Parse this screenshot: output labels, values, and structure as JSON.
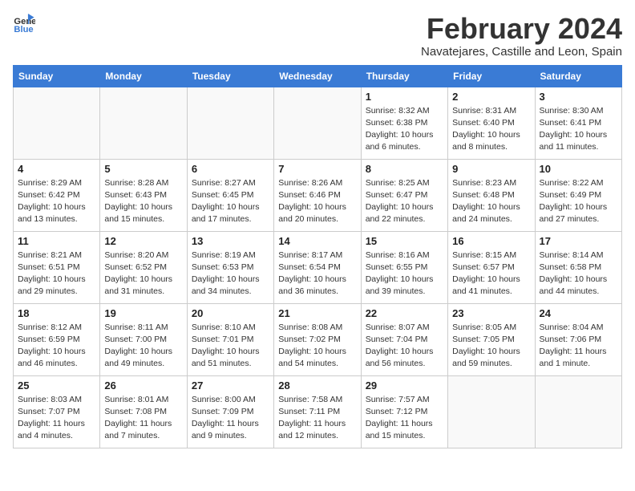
{
  "header": {
    "logo_general": "General",
    "logo_blue": "Blue",
    "title": "February 2024",
    "subtitle": "Navatejares, Castille and Leon, Spain"
  },
  "days_of_week": [
    "Sunday",
    "Monday",
    "Tuesday",
    "Wednesday",
    "Thursday",
    "Friday",
    "Saturday"
  ],
  "weeks": [
    [
      {
        "day": "",
        "info": ""
      },
      {
        "day": "",
        "info": ""
      },
      {
        "day": "",
        "info": ""
      },
      {
        "day": "",
        "info": ""
      },
      {
        "day": "1",
        "info": "Sunrise: 8:32 AM\nSunset: 6:38 PM\nDaylight: 10 hours\nand 6 minutes."
      },
      {
        "day": "2",
        "info": "Sunrise: 8:31 AM\nSunset: 6:40 PM\nDaylight: 10 hours\nand 8 minutes."
      },
      {
        "day": "3",
        "info": "Sunrise: 8:30 AM\nSunset: 6:41 PM\nDaylight: 10 hours\nand 11 minutes."
      }
    ],
    [
      {
        "day": "4",
        "info": "Sunrise: 8:29 AM\nSunset: 6:42 PM\nDaylight: 10 hours\nand 13 minutes."
      },
      {
        "day": "5",
        "info": "Sunrise: 8:28 AM\nSunset: 6:43 PM\nDaylight: 10 hours\nand 15 minutes."
      },
      {
        "day": "6",
        "info": "Sunrise: 8:27 AM\nSunset: 6:45 PM\nDaylight: 10 hours\nand 17 minutes."
      },
      {
        "day": "7",
        "info": "Sunrise: 8:26 AM\nSunset: 6:46 PM\nDaylight: 10 hours\nand 20 minutes."
      },
      {
        "day": "8",
        "info": "Sunrise: 8:25 AM\nSunset: 6:47 PM\nDaylight: 10 hours\nand 22 minutes."
      },
      {
        "day": "9",
        "info": "Sunrise: 8:23 AM\nSunset: 6:48 PM\nDaylight: 10 hours\nand 24 minutes."
      },
      {
        "day": "10",
        "info": "Sunrise: 8:22 AM\nSunset: 6:49 PM\nDaylight: 10 hours\nand 27 minutes."
      }
    ],
    [
      {
        "day": "11",
        "info": "Sunrise: 8:21 AM\nSunset: 6:51 PM\nDaylight: 10 hours\nand 29 minutes."
      },
      {
        "day": "12",
        "info": "Sunrise: 8:20 AM\nSunset: 6:52 PM\nDaylight: 10 hours\nand 31 minutes."
      },
      {
        "day": "13",
        "info": "Sunrise: 8:19 AM\nSunset: 6:53 PM\nDaylight: 10 hours\nand 34 minutes."
      },
      {
        "day": "14",
        "info": "Sunrise: 8:17 AM\nSunset: 6:54 PM\nDaylight: 10 hours\nand 36 minutes."
      },
      {
        "day": "15",
        "info": "Sunrise: 8:16 AM\nSunset: 6:55 PM\nDaylight: 10 hours\nand 39 minutes."
      },
      {
        "day": "16",
        "info": "Sunrise: 8:15 AM\nSunset: 6:57 PM\nDaylight: 10 hours\nand 41 minutes."
      },
      {
        "day": "17",
        "info": "Sunrise: 8:14 AM\nSunset: 6:58 PM\nDaylight: 10 hours\nand 44 minutes."
      }
    ],
    [
      {
        "day": "18",
        "info": "Sunrise: 8:12 AM\nSunset: 6:59 PM\nDaylight: 10 hours\nand 46 minutes."
      },
      {
        "day": "19",
        "info": "Sunrise: 8:11 AM\nSunset: 7:00 PM\nDaylight: 10 hours\nand 49 minutes."
      },
      {
        "day": "20",
        "info": "Sunrise: 8:10 AM\nSunset: 7:01 PM\nDaylight: 10 hours\nand 51 minutes."
      },
      {
        "day": "21",
        "info": "Sunrise: 8:08 AM\nSunset: 7:02 PM\nDaylight: 10 hours\nand 54 minutes."
      },
      {
        "day": "22",
        "info": "Sunrise: 8:07 AM\nSunset: 7:04 PM\nDaylight: 10 hours\nand 56 minutes."
      },
      {
        "day": "23",
        "info": "Sunrise: 8:05 AM\nSunset: 7:05 PM\nDaylight: 10 hours\nand 59 minutes."
      },
      {
        "day": "24",
        "info": "Sunrise: 8:04 AM\nSunset: 7:06 PM\nDaylight: 11 hours\nand 1 minute."
      }
    ],
    [
      {
        "day": "25",
        "info": "Sunrise: 8:03 AM\nSunset: 7:07 PM\nDaylight: 11 hours\nand 4 minutes."
      },
      {
        "day": "26",
        "info": "Sunrise: 8:01 AM\nSunset: 7:08 PM\nDaylight: 11 hours\nand 7 minutes."
      },
      {
        "day": "27",
        "info": "Sunrise: 8:00 AM\nSunset: 7:09 PM\nDaylight: 11 hours\nand 9 minutes."
      },
      {
        "day": "28",
        "info": "Sunrise: 7:58 AM\nSunset: 7:11 PM\nDaylight: 11 hours\nand 12 minutes."
      },
      {
        "day": "29",
        "info": "Sunrise: 7:57 AM\nSunset: 7:12 PM\nDaylight: 11 hours\nand 15 minutes."
      },
      {
        "day": "",
        "info": ""
      },
      {
        "day": "",
        "info": ""
      }
    ]
  ]
}
